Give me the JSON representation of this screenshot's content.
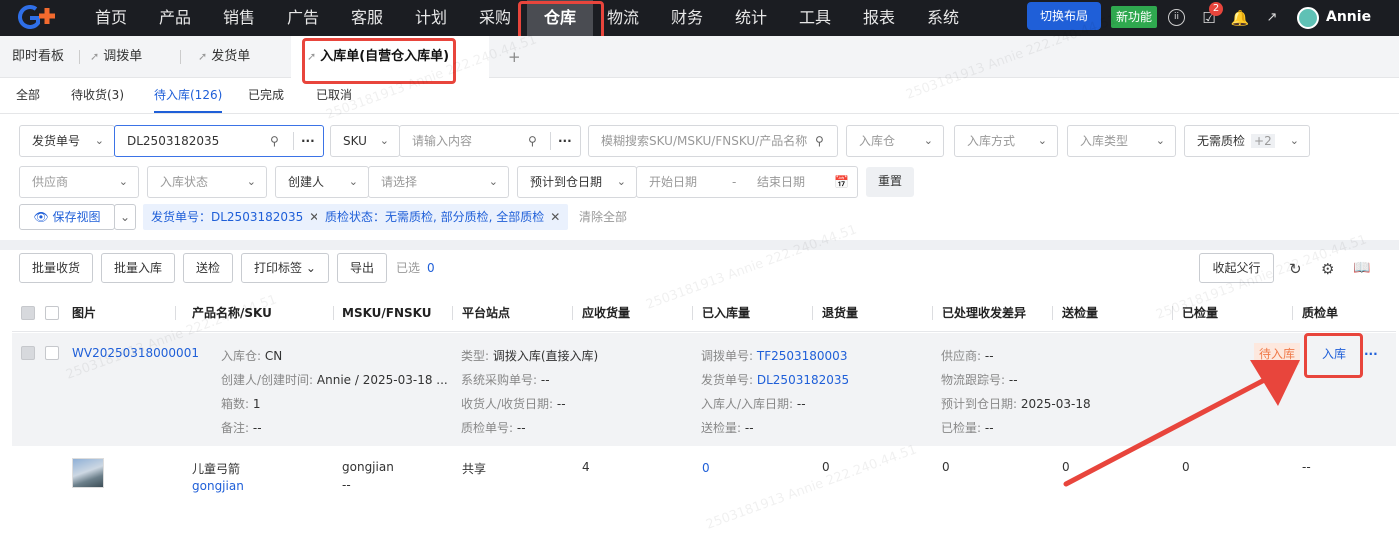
{
  "topnav": {
    "items": [
      "首页",
      "产品",
      "销售",
      "广告",
      "客服",
      "计划",
      "采购",
      "仓库",
      "物流",
      "财务",
      "统计",
      "工具",
      "报表",
      "系统"
    ],
    "switch_layout": "切换布局",
    "new_feature": "新功能",
    "badge_count": "2",
    "user": "Annie"
  },
  "tabs": {
    "dashboard": "即时看板",
    "transfer": "调拨单",
    "shipment": "发货单",
    "inbound": "入库单(自营仓入库单)",
    "add": "+"
  },
  "subtabs": [
    "全部",
    "待收货(3)",
    "待入库(126)",
    "已完成",
    "已取消"
  ],
  "filters": {
    "ship_no_select": "发货单号",
    "ship_no_value": "DL2503182035",
    "sku_select": "SKU",
    "sku_placeholder": "请输入内容",
    "fuzzy_placeholder": "模糊搜索SKU/MSKU/FNSKU/产品名称",
    "warehouse": "入库仓",
    "method": "入库方式",
    "type": "入库类型",
    "qc": "无需质检",
    "qc_more": "+2",
    "supplier": "供应商",
    "status": "入库状态",
    "creator": "创建人",
    "creator_placeholder": "请选择",
    "date_select": "预计到仓日期",
    "start_date": "开始日期",
    "date_sep": "-",
    "end_date": "结束日期",
    "reset": "重置",
    "save_view": "保存视图",
    "chip1": "发货单号：DL2503182035",
    "chip2": "质检状态：无需质检, 部分质检, 全部质检",
    "clear_all": "清除全部"
  },
  "toolbar": {
    "batch_receive": "批量收货",
    "batch_inbound": "批量入库",
    "send_qc": "送检",
    "print_label": "打印标签",
    "export": "导出",
    "selected_label": "已选",
    "selected_count": "0",
    "collapse_parent": "收起父行"
  },
  "table": {
    "headers": [
      "图片",
      "产品名称/SKU",
      "MSKU/FNSKU",
      "平台站点",
      "应收货量",
      "已入库量",
      "退货量",
      "已处理收发差异",
      "送检量",
      "已检量",
      "质检单"
    ],
    "group": {
      "order_no": "WV20250318000001",
      "warehouse_k": "入库仓:",
      "warehouse_v": "CN",
      "creator_k": "创建人/创建时间:",
      "creator_v": "Annie / 2025-03-18 ...",
      "boxes_k": "箱数:",
      "boxes_v": "1",
      "remark_k": "备注:",
      "remark_v": "--",
      "type_k": "类型:",
      "type_v": "调拨入库(直接入库)",
      "po_k": "系统采购单号:",
      "po_v": "--",
      "receiver_k": "收货人/收货日期:",
      "receiver_v": "--",
      "qcno_k": "质检单号:",
      "qcno_v": "--",
      "transfer_k": "调拨单号:",
      "transfer_v": "TF2503180003",
      "ship_k": "发货单号:",
      "ship_v": "DL2503182035",
      "inbounder_k": "入库人/入库日期:",
      "inbounder_v": "--",
      "sendqc_k": "送检量:",
      "sendqc_v": "--",
      "supplier_k": "供应商:",
      "supplier_v": "--",
      "tracking_k": "物流跟踪号:",
      "tracking_v": "--",
      "eta_k": "预计到仓日期:",
      "eta_v": "2025-03-18",
      "checked_k": "已检量:",
      "checked_v": "--",
      "status_badge": "待入库",
      "action": "入库",
      "more": "···"
    },
    "row": {
      "name": "儿童弓箭",
      "sku": "gongjian",
      "msku": "gongjian",
      "fnsku": "--",
      "site": "共享",
      "expected": "4",
      "inbound": "0",
      "returned": "0",
      "diff": "0",
      "sent_qc": "0",
      "checked": "0",
      "qc_doc": "--"
    }
  },
  "watermark": "2503181913 Annie 222.240.44.51",
  "colors": {
    "accent": "#1f5fd8",
    "highlight": "#e8453c",
    "nav_bg": "#1b1d22"
  }
}
